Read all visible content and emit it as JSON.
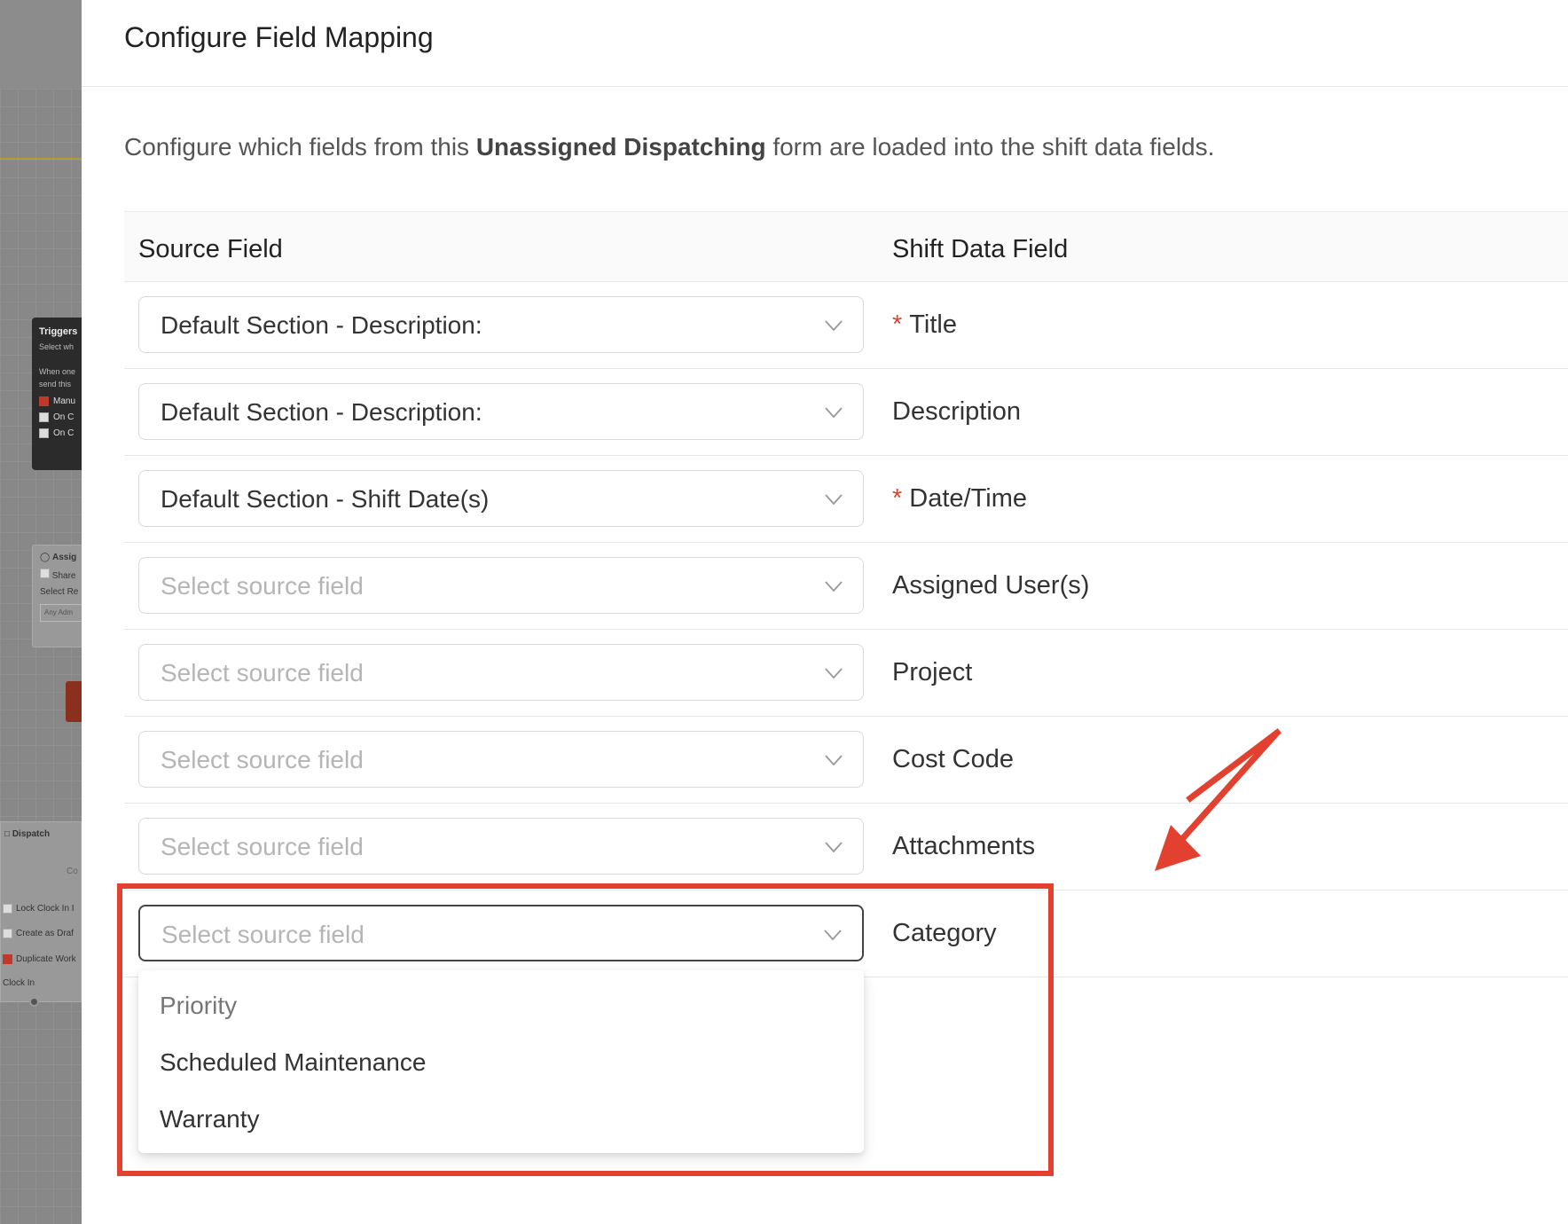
{
  "background": {
    "triggers": {
      "title": "Triggers",
      "subtitle": "Select wh",
      "desc_line1": "When one",
      "desc_line2": "send this",
      "items": [
        "Manu",
        "On C",
        "On C"
      ]
    },
    "assign": {
      "title": "Assig",
      "share": "Share",
      "select": "Select Re",
      "input": "Any Adm"
    },
    "dispatch": {
      "title": "Dispatch",
      "co": "Co",
      "rows": [
        "Lock Clock In I",
        "Create as Draf",
        "Duplicate Work"
      ],
      "clock": "Clock In"
    }
  },
  "dialog": {
    "title": "Configure Field Mapping",
    "intro_prefix": "Configure which fields from this ",
    "intro_bold": "Unassigned Dispatching",
    "intro_suffix": " form are loaded into the shift data fields."
  },
  "table": {
    "col_source": "Source Field",
    "col_shift": "Shift Data Field",
    "rows": [
      {
        "source": "Default Section - Description:",
        "field": "Title",
        "required": "*"
      },
      {
        "source": "Default Section - Description:",
        "field": "Description"
      },
      {
        "source": "Default Section - Shift Date(s)",
        "field": "Date/Time",
        "required": "*"
      },
      {
        "source": "Select source field",
        "field": "Assigned User(s)"
      },
      {
        "source": "Select source field",
        "field": "Project"
      },
      {
        "source": "Select source field",
        "field": "Cost Code"
      },
      {
        "source": "Select source field",
        "field": "Attachments"
      },
      {
        "source": "Select source field",
        "field": "Category"
      }
    ]
  },
  "dropdown": {
    "options": [
      "Priority",
      "Scheduled Maintenance",
      "Warranty"
    ]
  },
  "colors": {
    "accent_red": "#e3412f",
    "required": "#e0442c"
  }
}
